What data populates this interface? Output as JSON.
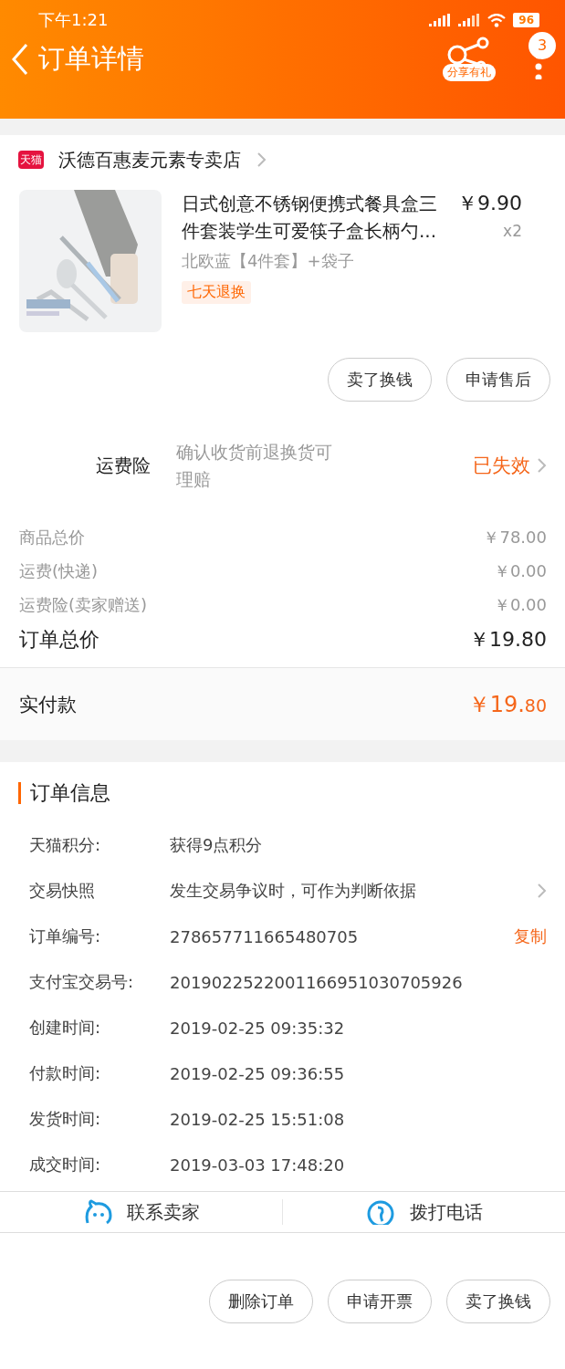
{
  "status_bar": {
    "time": "下午1:21",
    "battery": "96"
  },
  "header": {
    "title": "订单详情",
    "share_label": "分享有礼",
    "badge": "3"
  },
  "store": {
    "badge": "天猫",
    "name": "沃德百惠麦元素专卖店"
  },
  "product": {
    "title": "日式创意不锈钢便携式餐具盒三件套装学生可爱筷子盒长柄勺...",
    "price": "￥9.90",
    "quantity": "x2",
    "variant": "北欧蓝【4件套】+袋子",
    "tag": "七天退换"
  },
  "item_buttons": [
    "卖了换钱",
    "申请售后"
  ],
  "insurance": {
    "label": "运费险",
    "description": "确认收货前退换货可理赔",
    "status": "已失效"
  },
  "price_rows": [
    {
      "label": "商品总价",
      "value": "￥78.00"
    },
    {
      "label": "运费(快递)",
      "value": "￥0.00"
    },
    {
      "label": "运费险(卖家赠送)",
      "value": "￥0.00"
    }
  ],
  "order_total": {
    "label": "订单总价",
    "value": "￥19.80"
  },
  "paid": {
    "label": "实付款",
    "value": "￥19.**80**"
  },
  "order_info": {
    "title": "订单信息",
    "rows": [
      {
        "label": "天猫积分:",
        "value": "获得9点积分"
      },
      {
        "label": "交易快照",
        "value": "发生交易争议时，可作为判断依据",
        "kind": "link"
      },
      {
        "label": "订单编号:",
        "value": "278657711665480705",
        "action": "复制",
        "kind": "copy"
      },
      {
        "label": "支付宝交易号:",
        "value": "2019022522001166951030705926"
      },
      {
        "label": "创建时间:",
        "value": "2019-02-25 09:35:32"
      },
      {
        "label": "付款时间:",
        "value": "2019-02-25 09:36:55"
      },
      {
        "label": "发货时间:",
        "value": "2019-02-25 15:51:08"
      },
      {
        "label": "成交时间:",
        "value": "2019-03-03 17:48:20"
      }
    ]
  },
  "contact": [
    {
      "label": "联系卖家",
      "kind": "chat"
    },
    {
      "label": "拨打电话",
      "kind": "phone"
    }
  ],
  "bottom_buttons": [
    "删除订单",
    "申请开票",
    "卖了换钱"
  ]
}
